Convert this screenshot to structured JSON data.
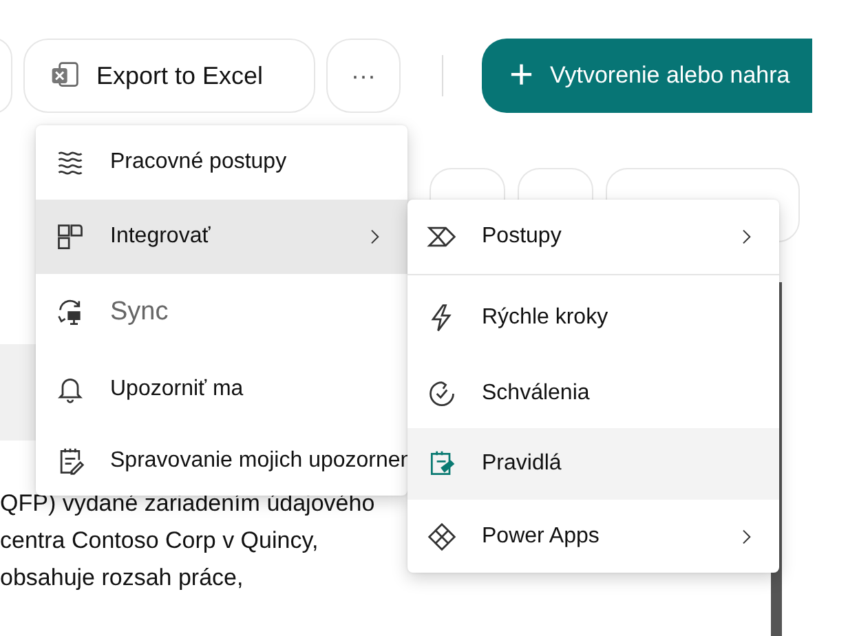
{
  "toolbar": {
    "export_button": "Export to Excel",
    "more_button": "···",
    "create_button": {
      "icon": "+",
      "label": "Vytvorenie alebo nahra"
    }
  },
  "menu": {
    "items": [
      {
        "label": "Pracovné postupy",
        "selected": false,
        "disabled": false,
        "submenu": false
      },
      {
        "label": "Integrovať",
        "selected": true,
        "disabled": false,
        "submenu": true
      },
      {
        "label": "Sync",
        "selected": false,
        "disabled": true,
        "submenu": false
      },
      {
        "label": "Upozorniť ma",
        "selected": false,
        "disabled": false,
        "submenu": false
      },
      {
        "label": "Spravovanie mojich upozornen",
        "selected": false,
        "disabled": false
      }
    ]
  },
  "submenu": {
    "items": [
      {
        "label": "Postupy",
        "selected": false,
        "submenu": true
      },
      {
        "label": "Rýchle kroky",
        "selected": false,
        "submenu": false
      },
      {
        "label": "Schválenia",
        "selected": false,
        "submenu": false
      },
      {
        "label": "Pravidlá",
        "selected": true,
        "submenu": false
      },
      {
        "label": "Power Apps",
        "selected": false,
        "submenu": true
      }
    ]
  },
  "body_lines": [
    "QFP) vydané zariadením údajového",
    "centra Contoso Corp v Quincy,",
    "obsahuje rozsah práce,"
  ]
}
